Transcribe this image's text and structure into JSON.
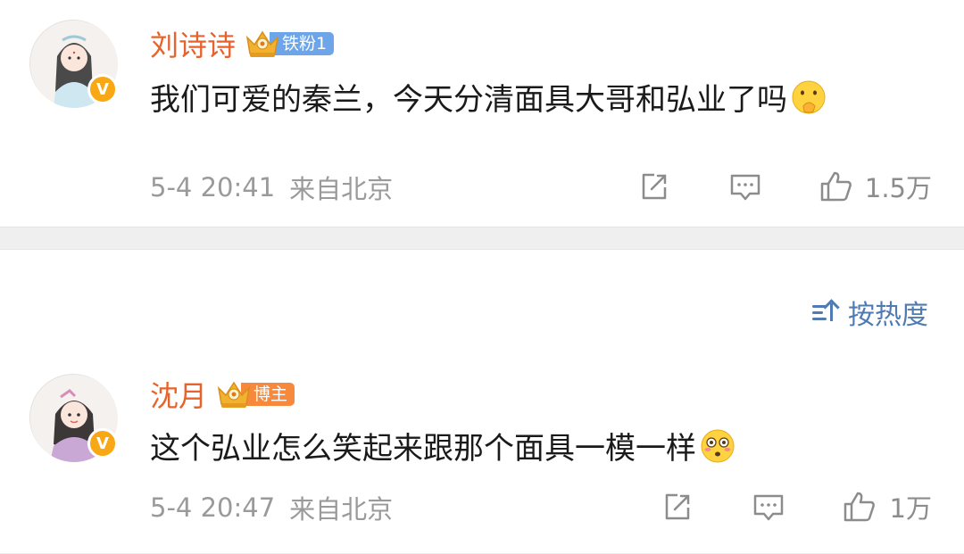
{
  "sort": {
    "label": "按热度"
  },
  "comments": [
    {
      "username": "刘诗诗",
      "fan_badge": "铁粉1",
      "text": "我们可爱的秦兰，今天分清面具大哥和弘业了吗",
      "emoji": "shushing-face-emoji",
      "verified": "V",
      "time": "5-4 20:41",
      "location": "来自北京",
      "likes": "1.5万"
    },
    {
      "username": "沈月",
      "fan_badge": "博主",
      "text": "这个弘业怎么笑起来跟那个面具一模一样",
      "emoji": "flushed-face-emoji",
      "verified": "V",
      "time": "5-4 20:47",
      "location": "来自北京",
      "likes": "1万"
    }
  ],
  "colors": {
    "username": "#e8632b",
    "fan_badge_blue": "#6ea5e8",
    "fan_badge_orange": "#f6893b",
    "sort_link": "#4f7bb2",
    "meta": "#9a9a9a",
    "verified": "#f7a814"
  },
  "icons": {
    "share": "share-icon",
    "comment": "comment-icon",
    "like": "thumbs-up-icon",
    "sort": "sort-icon",
    "crown": "crown-icon"
  }
}
